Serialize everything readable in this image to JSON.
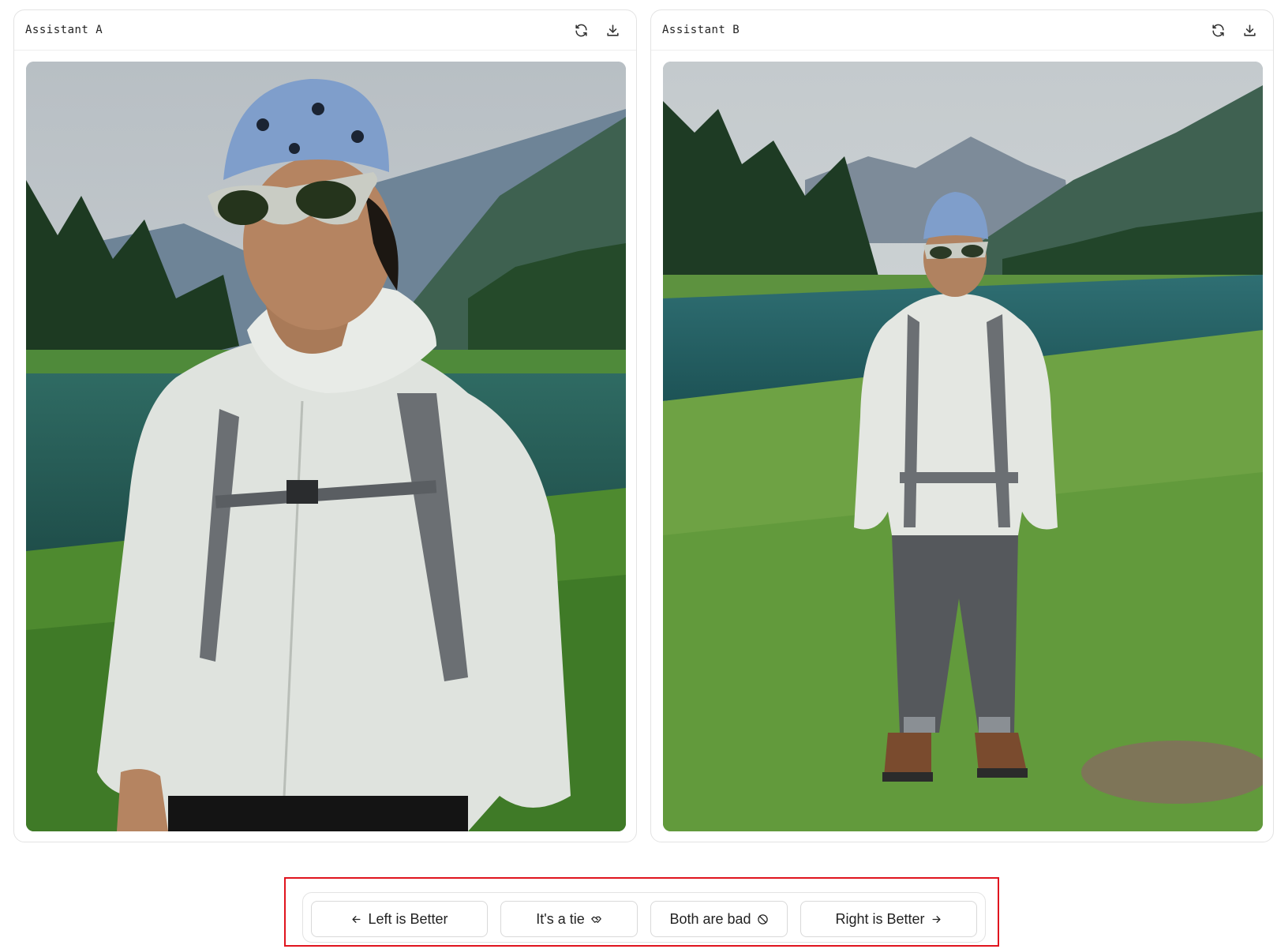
{
  "panels": {
    "left": {
      "title": "Assistant A",
      "image_alt": "AI-generated close-up of a hiker with blue bandana and sunglasses by a mountain lake"
    },
    "right": {
      "title": "Assistant B",
      "image_alt": "AI-generated full-body hiker standing on grass by a mountain lake"
    }
  },
  "icons": {
    "refresh": "refresh-icon",
    "download": "download-icon"
  },
  "vote": {
    "left_label": "Left is Better",
    "tie_label": "It's a tie",
    "bad_label": "Both are bad",
    "right_label": "Right is Better"
  },
  "colors": {
    "highlight": "#e0141e",
    "border": "#e3e3e3"
  }
}
